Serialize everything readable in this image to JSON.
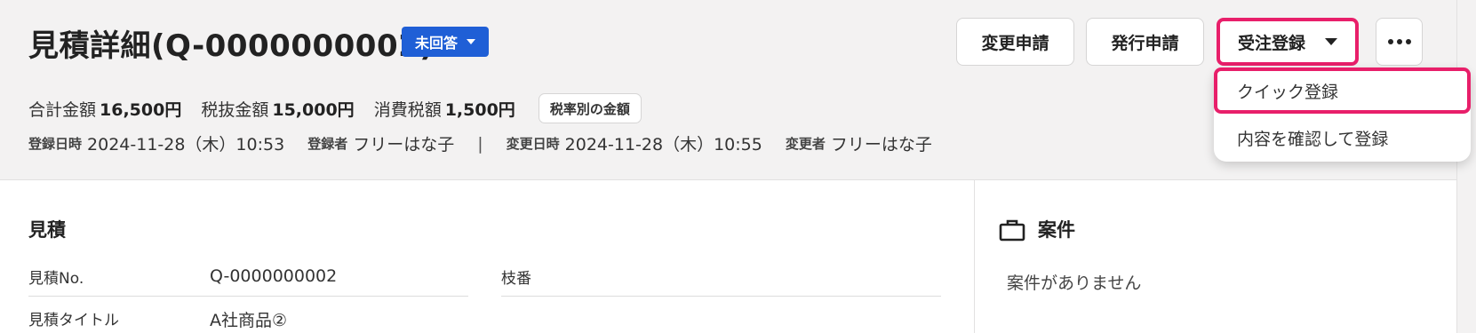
{
  "header": {
    "title": "見積詳細(Q-0000000002)",
    "status": "未回答",
    "buttons": {
      "change_request": "変更申請",
      "issue_request": "発行申請",
      "order_register": "受注登録"
    },
    "amounts": {
      "total_label": "合計金額",
      "total_value": "16,500円",
      "pretax_label": "税抜金額",
      "pretax_value": "15,000円",
      "tax_label": "消費税額",
      "tax_value": "1,500円",
      "by_rate_button": "税率別の金額"
    },
    "meta": {
      "created_at_label": "登録日時",
      "created_at": "2024-11-28（木）10:53",
      "created_by_label": "登録者",
      "created_by": "フリーはな子",
      "separator": "|",
      "updated_at_label": "変更日時",
      "updated_at": "2024-11-28（木）10:55",
      "updated_by_label": "変更者",
      "updated_by": "フリーはな子"
    }
  },
  "dropdown": {
    "items": [
      "クイック登録",
      "内容を確認して登録"
    ]
  },
  "estimate": {
    "title": "見積",
    "fields": {
      "no_label": "見積No.",
      "no_value": "Q-0000000002",
      "branch_label": "枝番",
      "title_label": "見積タイトル",
      "title_value": "A社商品②"
    }
  },
  "case": {
    "title": "案件",
    "empty": "案件がありません"
  },
  "colors": {
    "accent": "#1f5fd6",
    "highlight": "#e81f6a",
    "header_bg": "#f3f2f2"
  }
}
